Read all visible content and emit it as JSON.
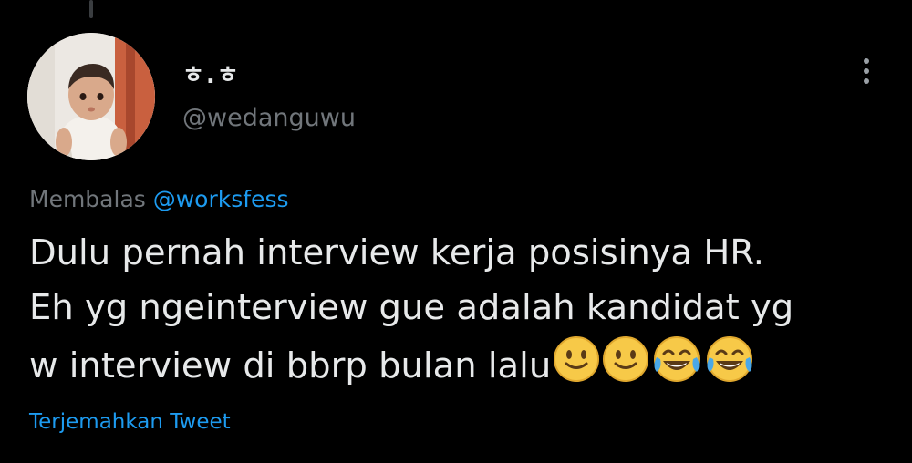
{
  "tweet": {
    "display_name": "ㅎ.ㅎ",
    "handle": "@wedanguwu",
    "reply_prefix": "Membalas ",
    "reply_to": "@worksfess",
    "text_lines": [
      "Dulu pernah interview kerja posisinya HR.",
      "Eh yg ngeinterview gue adalah kandidat yg",
      "w interview di bbrp bulan lalu"
    ],
    "emojis": [
      "slightly-smiling-face",
      "slightly-smiling-face",
      "face-with-tears-of-joy",
      "face-with-tears-of-joy"
    ],
    "translate_label": "Terjemahkan Tweet"
  },
  "icons": {
    "more": "more-vertical-icon"
  },
  "colors": {
    "background": "#000000",
    "text": "#e7e9ea",
    "muted": "#71767b",
    "link": "#1d9bf0"
  }
}
